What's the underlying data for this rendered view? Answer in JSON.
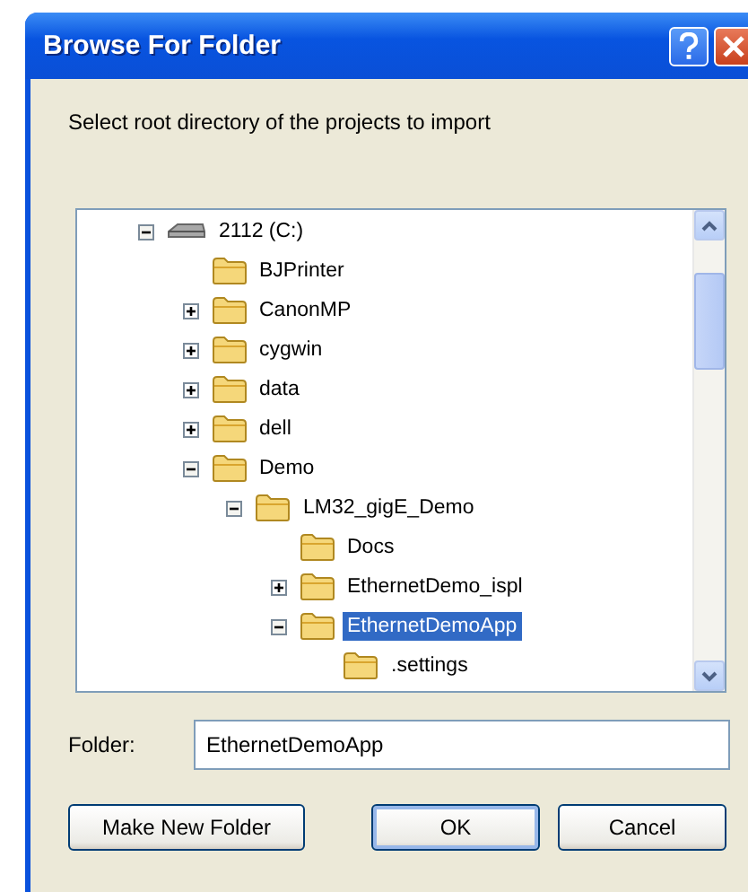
{
  "window": {
    "title": "Browse For Folder"
  },
  "instruction": "Select root directory of the projects to import",
  "tree": [
    {
      "label": "2112 (C:)",
      "kind": "drive",
      "expanded": true,
      "selected": false,
      "children": [
        {
          "label": "BJPrinter",
          "kind": "folder",
          "selected": false
        },
        {
          "label": "CanonMP",
          "kind": "folder",
          "expanded": false,
          "selected": false
        },
        {
          "label": "cygwin",
          "kind": "folder",
          "expanded": false,
          "selected": false
        },
        {
          "label": "data",
          "kind": "folder",
          "expanded": false,
          "selected": false
        },
        {
          "label": "dell",
          "kind": "folder",
          "expanded": false,
          "selected": false
        },
        {
          "label": "Demo",
          "kind": "folder",
          "expanded": true,
          "selected": false,
          "children": [
            {
              "label": "LM32_gigE_Demo",
              "kind": "folder",
              "expanded": true,
              "selected": false,
              "children": [
                {
                  "label": "Docs",
                  "kind": "folder",
                  "selected": false
                },
                {
                  "label": "EthernetDemo_ispl",
                  "kind": "folder",
                  "expanded": false,
                  "selected": false
                },
                {
                  "label": "EthernetDemoApp",
                  "kind": "folder",
                  "expanded": true,
                  "selected": true,
                  "children": [
                    {
                      "label": ".settings",
                      "kind": "folder",
                      "selected": false
                    }
                  ]
                }
              ]
            }
          ]
        }
      ]
    }
  ],
  "folder_field": {
    "label": "Folder:",
    "value": "EthernetDemoApp"
  },
  "buttons": [
    {
      "label": "Make New Folder",
      "kind": "secondary"
    },
    {
      "label": "OK",
      "kind": "default"
    },
    {
      "label": "Cancel",
      "kind": "secondary"
    }
  ]
}
